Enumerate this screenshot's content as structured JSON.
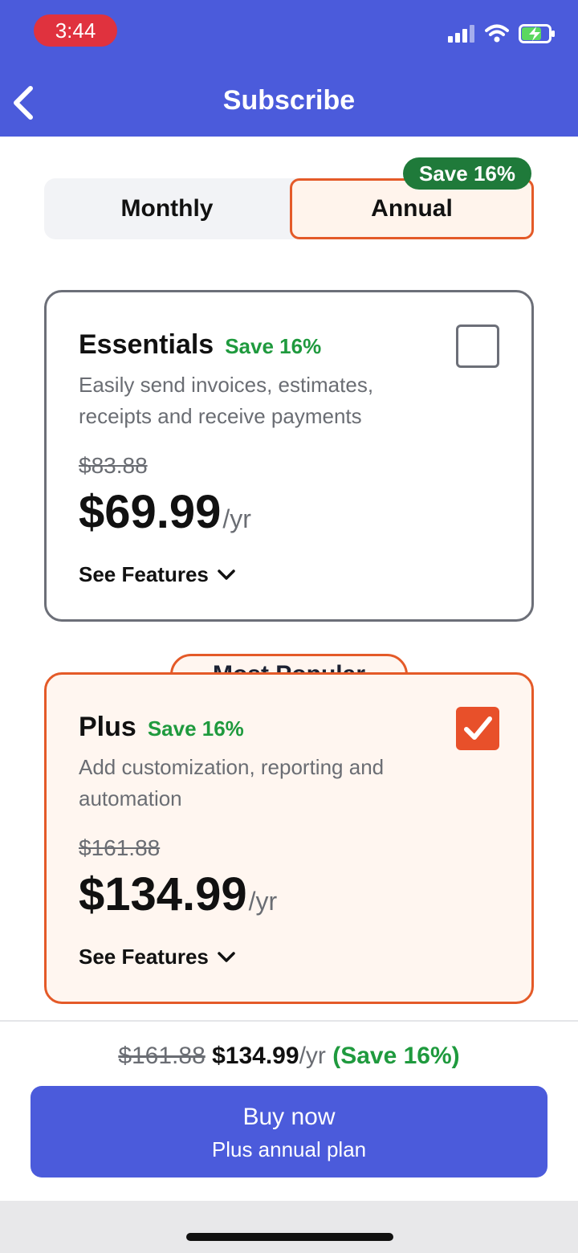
{
  "status_bar": {
    "time": "3:44",
    "icons": [
      "signal-icon",
      "wifi-icon",
      "battery-charging-icon"
    ]
  },
  "header": {
    "title": "Subscribe",
    "back_icon": "chevron-left-icon"
  },
  "billing_toggle": {
    "options": [
      "Monthly",
      "Annual"
    ],
    "selected": "Annual",
    "save_badge": "Save 16%"
  },
  "plans": [
    {
      "name": "Essentials",
      "save": "Save 16%",
      "description": "Easily send invoices, estimates, receipts and receive payments",
      "original_price": "$83.88",
      "price": "$69.99",
      "period": "/yr",
      "features_label": "See Features",
      "selected": false
    },
    {
      "name": "Plus",
      "badge": "Most Popular",
      "save": "Save 16%",
      "description": "Add customization, reporting and automation",
      "original_price": "$161.88",
      "price": "$134.99",
      "period": "/yr",
      "features_label": "See Features",
      "selected": true
    }
  ],
  "summary": {
    "original_price": "$161.88",
    "price": "$134.99",
    "period": "/yr",
    "save": "(Save 16%)"
  },
  "buy_button": {
    "label": "Buy now",
    "sublabel": "Plus annual plan"
  },
  "colors": {
    "brand": "#4b5bdb",
    "accent": "#e45a28",
    "save_green": "#1f9a3e",
    "badge_green": "#1f7a3a"
  }
}
